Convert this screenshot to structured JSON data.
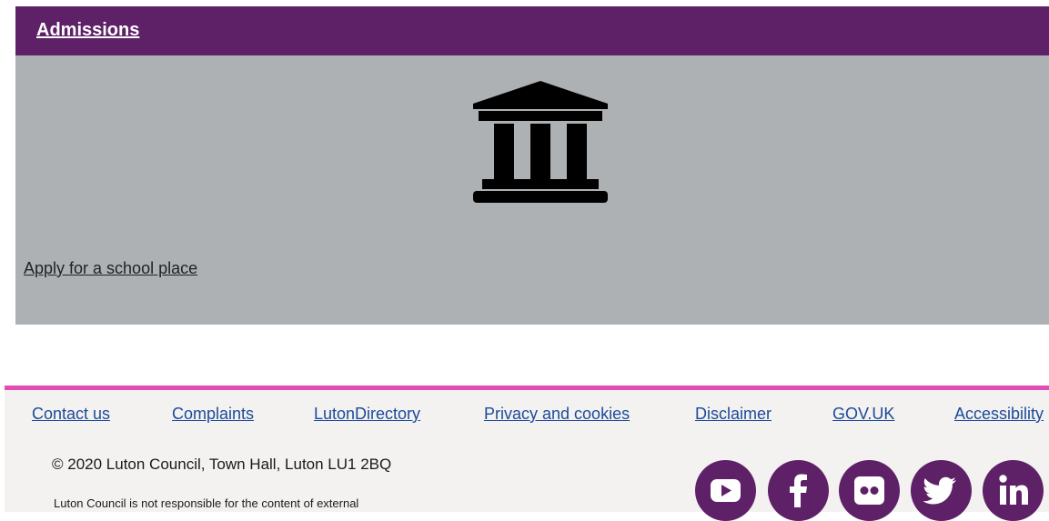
{
  "card": {
    "title": "Admissions",
    "link": "Apply for a school place",
    "icon": "bank-icon",
    "header_color": "#5e2167",
    "body_color": "#aeb1b4"
  },
  "footer": {
    "accent_color": "#e24db4",
    "links": [
      "Contact us",
      "Complaints",
      "LutonDirectory",
      "Privacy and cookies",
      "Disclaimer",
      "GOV.UK",
      "Accessibility"
    ],
    "copyright": "© 2020 Luton Council, Town Hall, Luton LU1 2BQ",
    "disclaimer": "Luton Council is not responsible for the content of external",
    "social_icons": [
      "youtube-icon",
      "facebook-icon",
      "flickr-icon",
      "twitter-icon",
      "linkedin-icon"
    ]
  }
}
